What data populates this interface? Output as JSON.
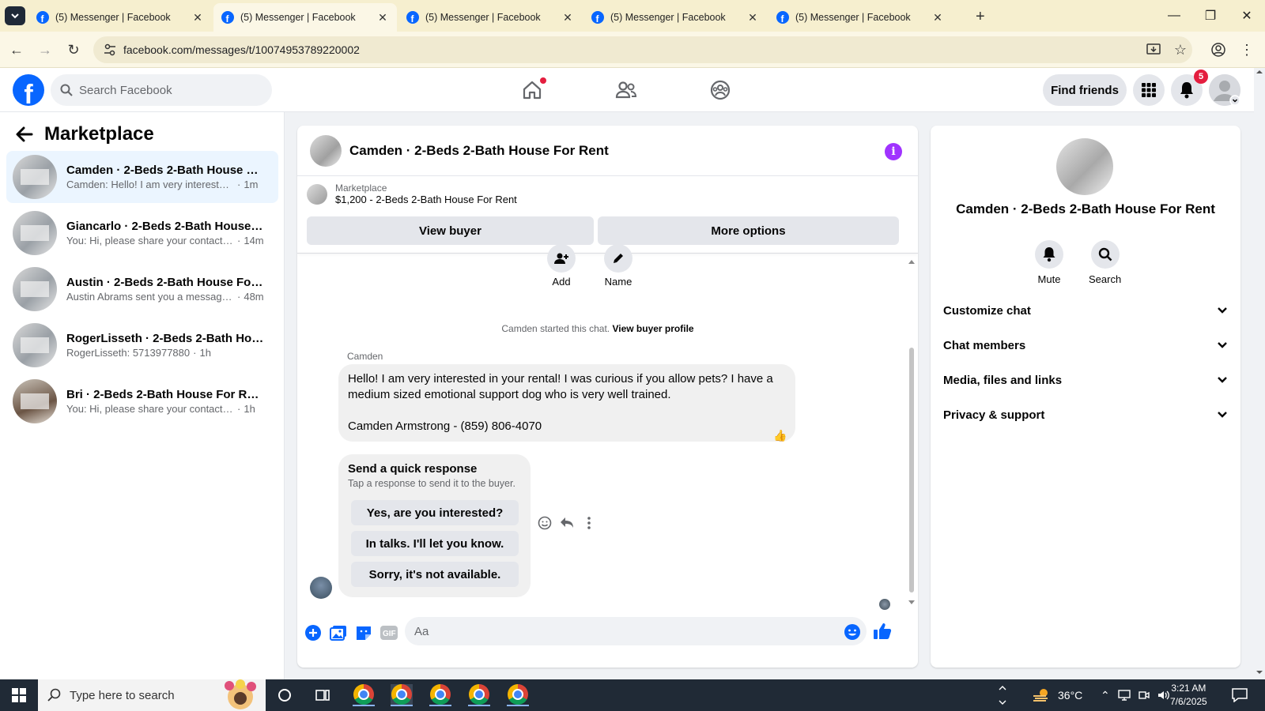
{
  "browser": {
    "tabs": [
      {
        "title": "(5) Messenger | Facebook",
        "active": false
      },
      {
        "title": "(5) Messenger | Facebook",
        "active": true
      },
      {
        "title": "(5) Messenger | Facebook",
        "active": false
      },
      {
        "title": "(5) Messenger | Facebook",
        "active": false
      },
      {
        "title": "(5) Messenger | Facebook",
        "active": false
      }
    ],
    "url": "facebook.com/messages/t/10074953789220002"
  },
  "header": {
    "search_placeholder": "Search Facebook",
    "find_friends_label": "Find friends",
    "notification_count": "5",
    "brand_color": "#0866ff"
  },
  "left": {
    "title": "Marketplace",
    "conversations": [
      {
        "name": "Camden · 2-Beds 2-Bath House Fo...",
        "preview": "Camden: Hello! I am very interested i...",
        "time": "1m",
        "selected": true
      },
      {
        "name": "Giancarlo · 2-Beds 2-Bath House F...",
        "preview": "You: Hi, please share your contact n...",
        "time": "14m",
        "selected": false
      },
      {
        "name": "Austin · 2-Beds 2-Bath House For ...",
        "preview": "Austin Abrams sent you a message ...",
        "time": "48m",
        "selected": false
      },
      {
        "name": "RogerLisseth · 2-Beds 2-Bath Hous...",
        "preview": "RogerLisseth: 5713977880",
        "time": "1h",
        "selected": false
      },
      {
        "name": "Bri · 2-Beds 2-Bath House For Rent",
        "preview": "You: Hi, please share your contact nu...",
        "time": "1h",
        "selected": false
      }
    ]
  },
  "chat": {
    "title": "Camden · 2-Beds 2-Bath House For Rent",
    "marketplace_label": "Marketplace",
    "listing": "$1,200 - 2-Beds 2-Bath House For Rent",
    "view_buyer_label": "View buyer",
    "more_options_label": "More options",
    "add_label": "Add",
    "name_label": "Name",
    "started_prefix": "Camden started this chat.",
    "view_buyer_profile": "View buyer profile",
    "sender": "Camden",
    "message_line1": "Hello! I am very interested in your rental! I was curious if you allow pets? I have a",
    "message_line2": "medium sized emotional support dog who is very well trained.",
    "message_line3": "Camden Armstrong - (859) 806-4070",
    "quick_response": {
      "title": "Send a quick response",
      "subtitle": "Tap a response to send it to the buyer.",
      "options": [
        "Yes, are you interested?",
        "In talks. I'll let you know.",
        "Sorry, it's not available."
      ]
    },
    "composer_placeholder": "Aa"
  },
  "right": {
    "title": "Camden · 2-Beds 2-Bath House For Rent",
    "mute_label": "Mute",
    "search_label": "Search",
    "sections": [
      "Customize chat",
      "Chat members",
      "Media, files and links",
      "Privacy & support"
    ]
  },
  "taskbar": {
    "search_placeholder": "Type here to search",
    "temperature": "36°C",
    "time": "3:21 AM",
    "date": "7/6/2025"
  }
}
